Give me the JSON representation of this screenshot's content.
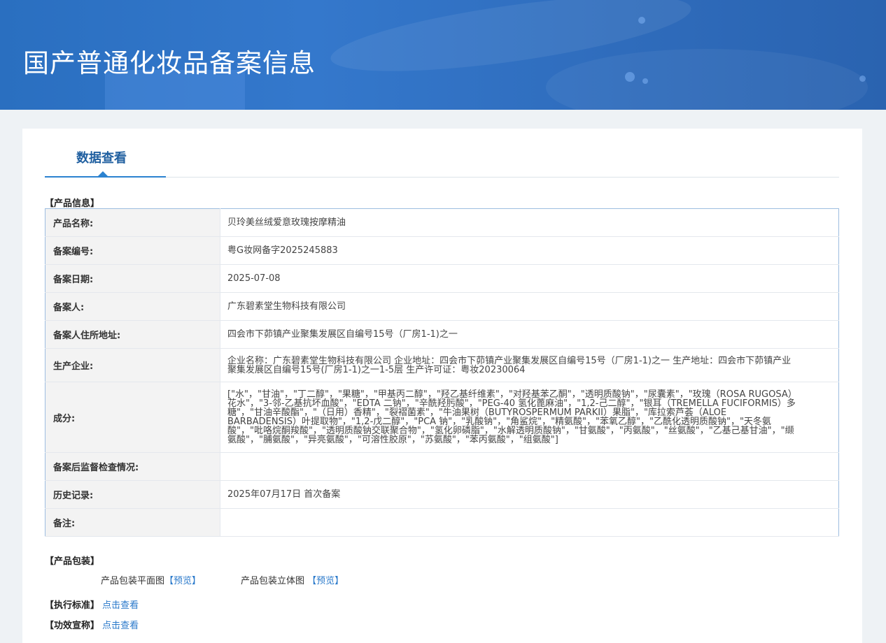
{
  "header": {
    "title": "国产普通化妆品备案信息"
  },
  "tabs": [
    {
      "label": "数据查看"
    }
  ],
  "product_info": {
    "section_label": "【产品信息】",
    "rows": [
      {
        "label": "产品名称:",
        "value": "贝玲美丝绒爱意玫瑰按摩精油"
      },
      {
        "label": "备案编号:",
        "value": "粤G妆网备字2025245883"
      },
      {
        "label": "备案日期:",
        "value": "2025-07-08"
      },
      {
        "label": "备案人:",
        "value": "广东碧素堂生物科技有限公司"
      },
      {
        "label": "备案人住所地址:",
        "value": "四会市下茆镇产业聚集发展区自编号15号（厂房1-1)之一"
      },
      {
        "label": "生产企业:",
        "value": "企业名称：广东碧素堂生物科技有限公司 企业地址：四会市下茆镇产业聚集发展区自编号15号（厂房1-1)之一 生产地址：四会市下茆镇产业聚集发展区自编号15号(厂房1-1)之一1-5层 生产许可证：粤妆20230064"
      },
      {
        "label": "成分:",
        "value": "[\"水\"，\"甘油\"，\"丁二醇\"，\"果糖\"，\"甲基丙二醇\"，\"羟乙基纤维素\"，\"对羟基苯乙酮\"，\"透明质酸钠\"，\"尿囊素\"，\"玫瑰（ROSA RUGOSA）花水\"，\"3-邻-乙基抗坏血酸\"，\"EDTA 二钠\"，\"辛酰羟肟酸\"，\"PEG-40 氢化蓖麻油\"，\"1,2-己二醇\"，\"银耳（TREMELLA FUCIFORMIS）多糖\"，\"甘油辛酸酯\"，\"（日用）香精\"，\"裂褶菌素\"，\"牛油果树（BUTYROSPERMUM PARKII）果脂\"，\"库拉索芦荟（ALOE BARBADENSIS）叶提取物\"，\"1,2-戊二醇\"，\"PCA 钠\"，\"乳酸钠\"，\"角鲨烷\"，\"精氨酸\"，\"苯氧乙醇\"，\"乙酰化透明质酸钠\"，\"天冬氨酸\"，\"吡咯烷酮羧酸\"，\"透明质酸钠交联聚合物\"，\"氢化卵磷脂\"，\"水解透明质酸钠\"，\"甘氨酸\"，\"丙氨酸\"，\"丝氨酸\"，\"乙基己基甘油\"，\"缬氨酸\"，\"脯氨酸\"，\"异亮氨酸\"，\"可溶性胶原\"，\"苏氨酸\"，\"苯丙氨酸\"，\"组氨酸\"]"
      },
      {
        "label": "备案后监督检查情况:",
        "value": ""
      },
      {
        "label": "历史记录:",
        "value": "2025年07月17日 首次备案"
      },
      {
        "label": "备注:",
        "value": ""
      }
    ]
  },
  "packaging": {
    "section_label": "【产品包装】",
    "flat_label": "产品包装平面图",
    "flat_link": "【预览】",
    "solid_label": "产品包装立体图",
    "solid_link": "【预览】"
  },
  "standard": {
    "label": "【执行标准】",
    "link": "点击查看"
  },
  "efficacy": {
    "label": "【功效宣称】",
    "link": "点击查看"
  }
}
